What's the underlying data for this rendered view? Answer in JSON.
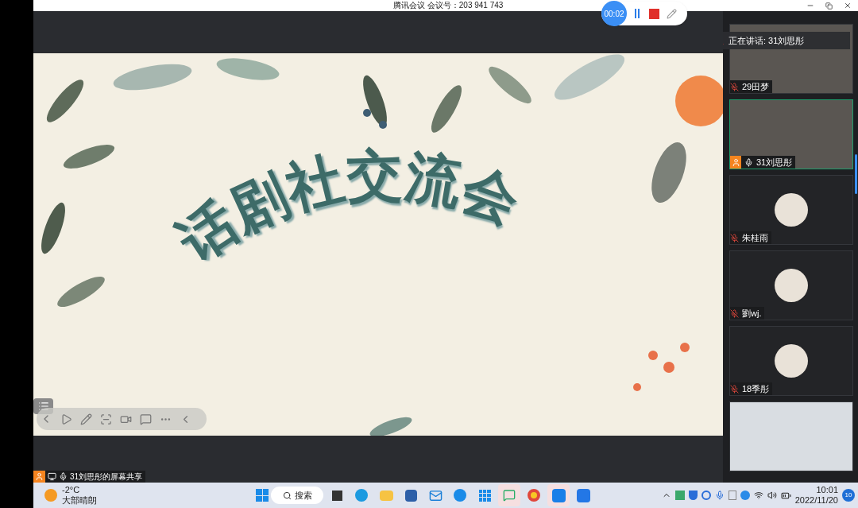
{
  "window": {
    "title": "腾讯会议 会议号：203 941 743"
  },
  "recording": {
    "time": "00:02"
  },
  "slide": {
    "title": "话剧社交流会"
  },
  "speaking_banner": {
    "text": "正在讲话: 31刘思彤"
  },
  "participants": [
    {
      "kind": "video",
      "name": "29田梦",
      "muted": true,
      "host": false,
      "selected": false
    },
    {
      "kind": "video",
      "name": "31刘思彤",
      "muted": false,
      "host": true,
      "selected": true
    },
    {
      "kind": "avatar",
      "name": "朱桂雨",
      "muted": true,
      "host": false,
      "selected": false
    },
    {
      "kind": "avatar",
      "name": "劉wj.",
      "muted": true,
      "host": false,
      "selected": false
    },
    {
      "kind": "avatar",
      "name": "18季彤",
      "muted": true,
      "host": false,
      "selected": false
    },
    {
      "kind": "video",
      "selected": false
    }
  ],
  "share_label": {
    "text": "31刘思彤的屏幕共享"
  },
  "taskbar": {
    "temperature": "-2°C",
    "weather": "大部晴朗",
    "search_placeholder": "搜索",
    "time": "10:01",
    "date": "2022/11/20",
    "notifications": "10"
  }
}
